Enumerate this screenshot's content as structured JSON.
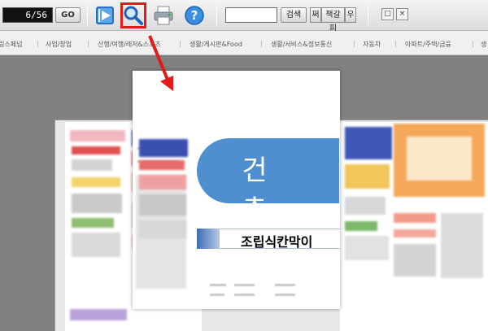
{
  "toolbar": {
    "page_indicator": "6/56",
    "go_label": "GO",
    "search_value": "",
    "search_label": "검색",
    "prev_hit_label": "쩌",
    "next_hit_label": "책갈피",
    "extra_label": "우",
    "restore_glyph": "□",
    "close_glyph": "×",
    "icons": [
      "media-play-icon",
      "zoom-icon",
      "print-icon",
      "help-icon"
    ]
  },
  "categories": [
    "링스페넘",
    "사업/창업",
    "산행/여행/레저&스포츠",
    "생활/게시판&Food",
    "생활/서비스&정보통신",
    "자동차",
    "아파트/주택/금융",
    "생"
  ],
  "magnified": {
    "heading": "건 축",
    "subheading": "조립식칸막이"
  },
  "colors": {
    "accent_blue": "#4f8fd0",
    "highlight_red": "#e21a1a"
  }
}
